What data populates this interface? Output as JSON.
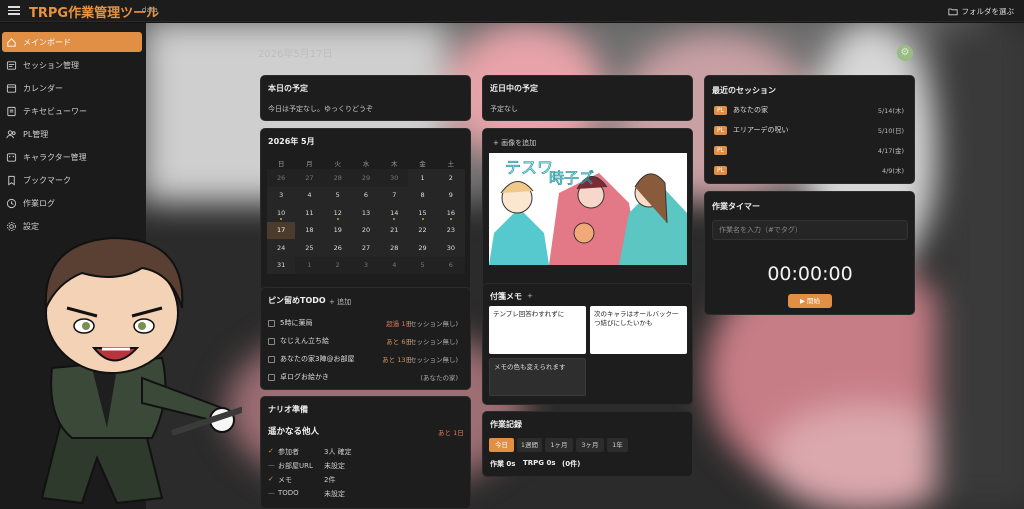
{
  "header": {
    "title": "TRPG作業管理ツール",
    "subtitle": "data",
    "folder_label": "フォルダを選ぶ"
  },
  "sidebar": {
    "items": [
      {
        "label": "メインボード",
        "icon": "home-icon",
        "active": true
      },
      {
        "label": "セッション管理",
        "icon": "calendar-list-icon"
      },
      {
        "label": "カレンダー",
        "icon": "calendar-icon"
      },
      {
        "label": "テキセビューワー",
        "icon": "document-icon"
      },
      {
        "label": "PL管理",
        "icon": "users-icon"
      },
      {
        "label": "キャラクター管理",
        "icon": "character-icon"
      },
      {
        "label": "ブックマーク",
        "icon": "bookmark-icon"
      },
      {
        "label": "作業ログ",
        "icon": "clock-icon"
      },
      {
        "label": "設定",
        "icon": "gear-icon"
      }
    ]
  },
  "date_heading": "2026年5月17日",
  "today": {
    "title": "本日の予定",
    "text": "今日は予定なし。ゆっくりどうぞ"
  },
  "upcoming": {
    "title": "近日中の予定",
    "text": "予定なし"
  },
  "recent": {
    "title": "最近のセッション",
    "items": [
      {
        "badge": "PL",
        "name": "あなたの家",
        "date": "5/14(木)"
      },
      {
        "badge": "PL",
        "name": "エリアーデの呪い",
        "date": "5/10(日)"
      },
      {
        "badge": "PL",
        "name": "",
        "date": "4/17(金)"
      },
      {
        "badge": "PL",
        "name": "",
        "date": "4/9(木)"
      }
    ]
  },
  "calendar": {
    "title": "2026年 5月",
    "weekdays": [
      "日",
      "月",
      "火",
      "水",
      "木",
      "金",
      "土"
    ],
    "weeks": [
      [
        "26",
        "27",
        "28",
        "29",
        "30",
        "1",
        "2"
      ],
      [
        "3",
        "4",
        "5",
        "6",
        "7",
        "8",
        "9"
      ],
      [
        "10",
        "11",
        "12",
        "13",
        "14",
        "15",
        "16"
      ],
      [
        "17",
        "18",
        "19",
        "20",
        "21",
        "22",
        "23"
      ],
      [
        "24",
        "25",
        "26",
        "27",
        "28",
        "29",
        "30"
      ],
      [
        "31",
        "1",
        "2",
        "3",
        "4",
        "5",
        "6"
      ]
    ]
  },
  "image_card": {
    "add_label": "+ 画像を追加",
    "art_text_1": "テスワ",
    "art_text_2": "時子ズ"
  },
  "memo": {
    "title": "付箋メモ",
    "add": "+",
    "notes": [
      "テンプレ回答わすれずに",
      "次のキャラはオールバック一つ結びにしたいかも",
      "メモの色も変えられます"
    ]
  },
  "timer": {
    "title": "作業タイマー",
    "placeholder": "作業名を入力（#でタグ）",
    "time": "00:00:00",
    "start_label": "▶ 開始"
  },
  "todo": {
    "title": "ピン留めTODO",
    "add": "+ 追加",
    "items": [
      {
        "text": "5時に薬局",
        "due": "超過 1日",
        "cat": "(セッション無し)"
      },
      {
        "text": "なじえん立ち絵",
        "due": "あと 6日",
        "cat": "(セッション無し)"
      },
      {
        "text": "あなたの家3陣@お部屋",
        "due": "あと 13日",
        "cat": "(セッション無し)"
      },
      {
        "text": "卓ログお絵かき",
        "due": "",
        "cat": "(あなたの家)"
      }
    ]
  },
  "prep": {
    "title": "ナリオ準備",
    "scenario": "遥かなる他人",
    "remaining": "あと 1日",
    "rows": [
      {
        "mark": "✓",
        "label": "参加者",
        "value": "3人 確定"
      },
      {
        "mark": "—",
        "label": "お部屋URL",
        "value": "未設定"
      },
      {
        "mark": "✓",
        "label": "メモ",
        "value": "2件"
      },
      {
        "mark": "—",
        "label": "TODO",
        "value": "未設定"
      }
    ]
  },
  "worklog": {
    "title": "作業記録",
    "tabs": [
      "今日",
      "1週間",
      "1ヶ月",
      "3ヶ月",
      "1年"
    ],
    "summary_1": "作業 0s",
    "summary_2": "TRPG 0s",
    "summary_3": "(0件)"
  }
}
